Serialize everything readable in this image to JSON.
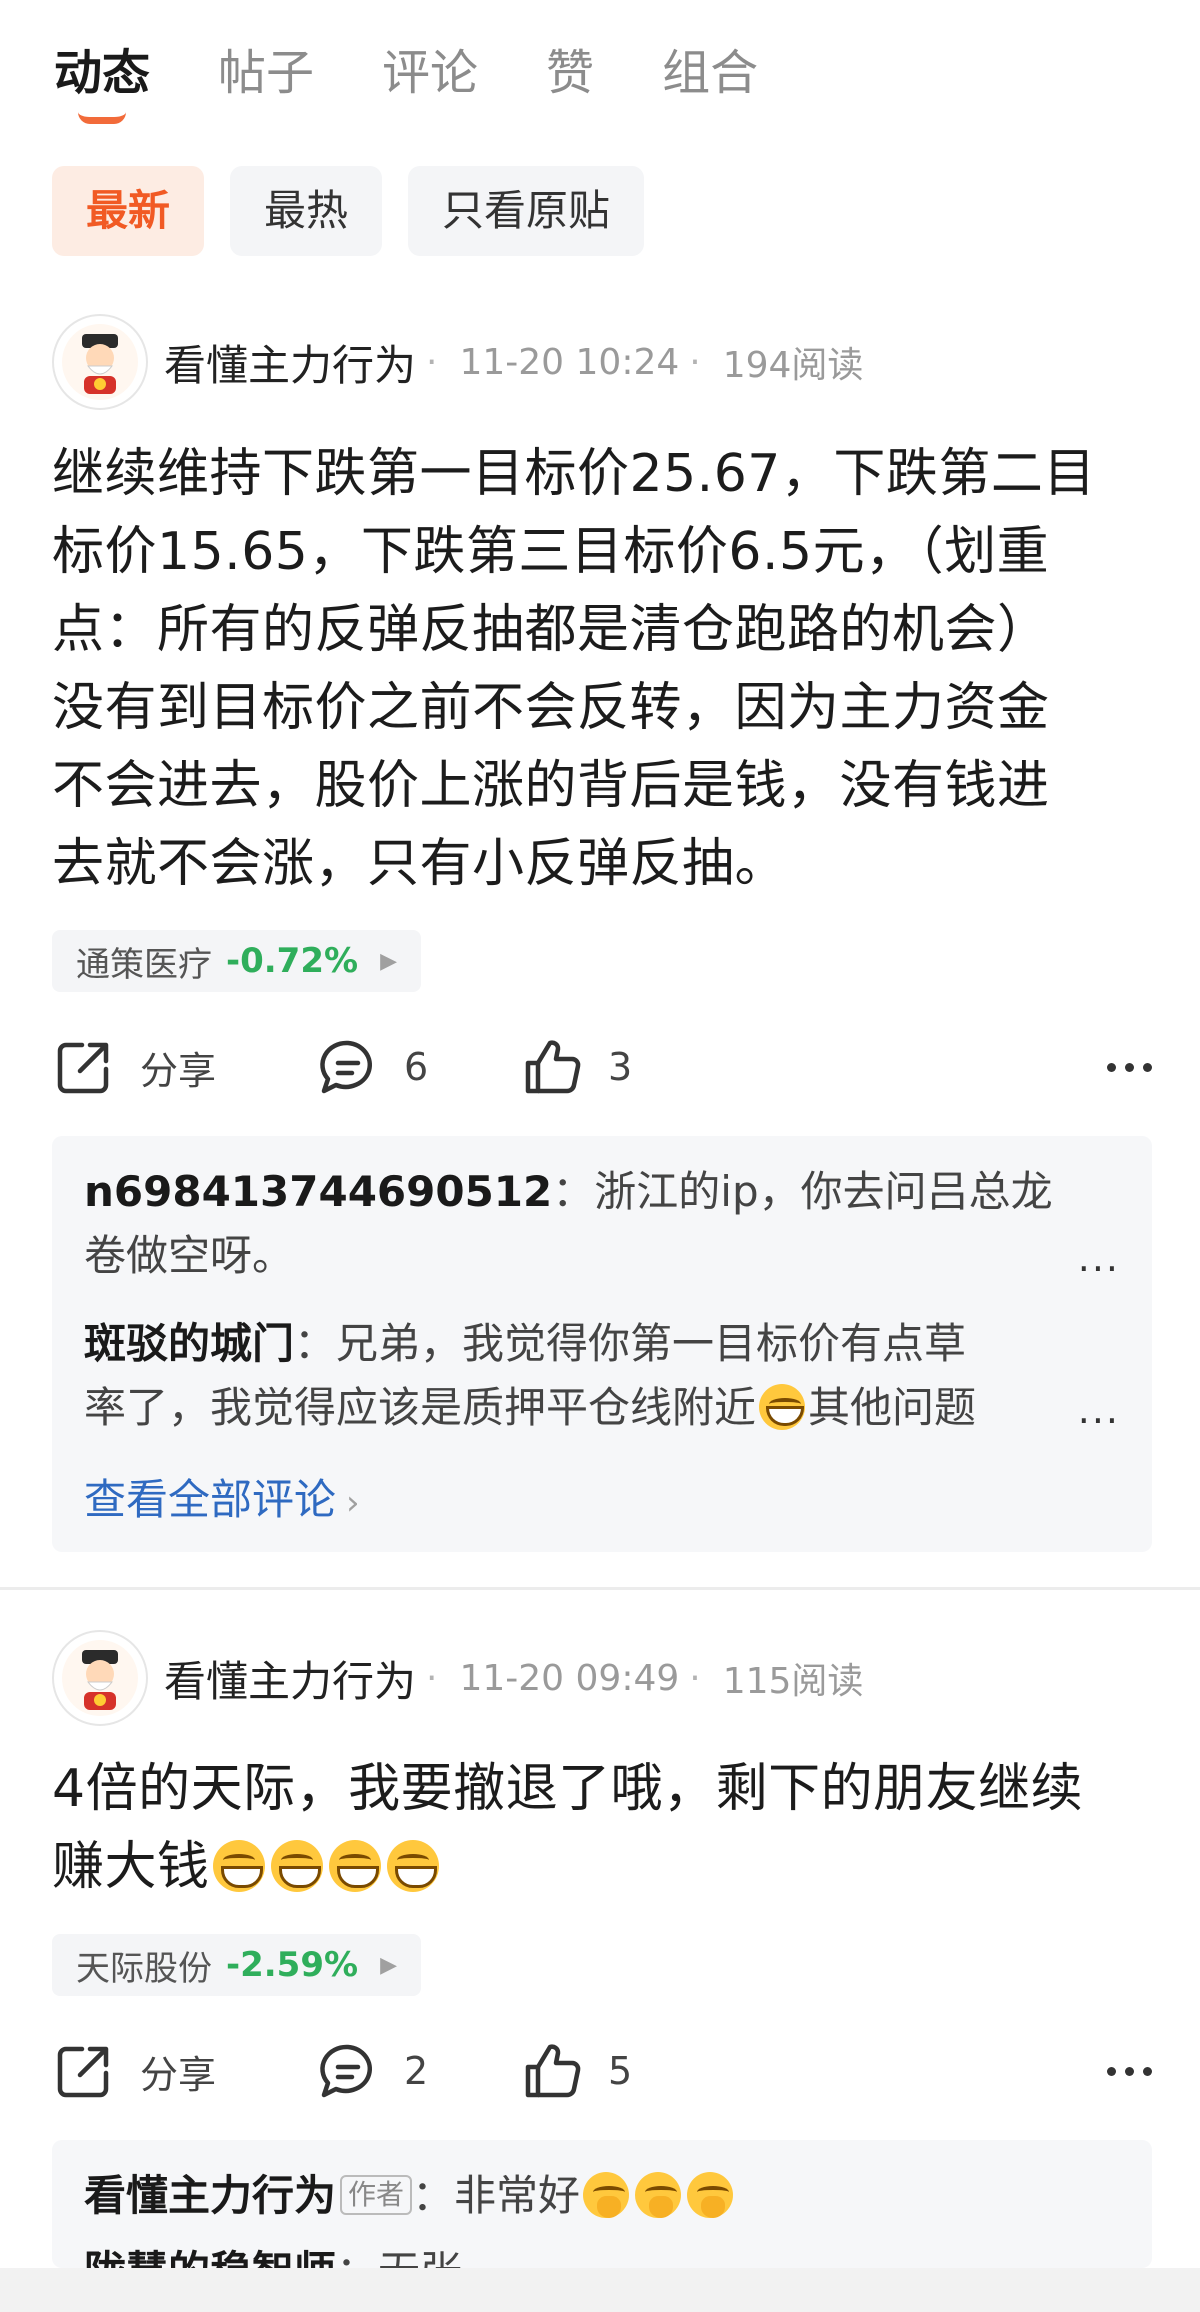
{
  "tabs": [
    {
      "label": "动态",
      "active": true
    },
    {
      "label": "帖子",
      "active": false
    },
    {
      "label": "评论",
      "active": false
    },
    {
      "label": "赞",
      "active": false
    },
    {
      "label": "组合",
      "active": false
    }
  ],
  "filters": [
    {
      "label": "最新",
      "active": true
    },
    {
      "label": "最热",
      "active": false
    },
    {
      "label": "只看原贴",
      "active": false
    }
  ],
  "colors": {
    "accent": "#f15a24",
    "down_green": "#2fae5b",
    "link_blue": "#2f6ac1"
  },
  "posts": [
    {
      "author": "看懂主力行为",
      "time": "11-20 10:24",
      "reads": "194阅读",
      "content_lines": [
        "继续维持下跌第一目标价25.67，下跌第二目",
        "标价15.65，下跌第三目标价6.5元，（划重",
        "点：所有的反弹反抽都是清仓跑路的机会）",
        "没有到目标价之前不会反转，因为主力资金",
        "不会进去，股价上涨的背后是钱，没有钱进",
        "去就不会涨，只有小反弹反抽。"
      ],
      "stock": {
        "name": "通策医疗",
        "change": "-0.72%"
      },
      "actions": {
        "share": "分享",
        "comments": "6",
        "likes": "3"
      },
      "comments": [
        {
          "user": "n698413744690512",
          "sep": "：",
          "line1": "浙江的ip，你去问吕总龙",
          "line2": "卷做空呀。"
        },
        {
          "user": "斑驳的城门",
          "sep": "：",
          "line1": "兄弟，我觉得你第一目标价有点草",
          "line2a": "率了，我觉得应该是质押平仓线附近",
          "line2b": "其他问题"
        }
      ],
      "view_all": "查看全部评论"
    },
    {
      "author": "看懂主力行为",
      "time": "11-20 09:49",
      "reads": "115阅读",
      "content_lines": [
        "4倍的天际，我要撤退了哦，剩下的朋友继续",
        "赚大钱"
      ],
      "stock": {
        "name": "天际股份",
        "change": "-2.59%"
      },
      "actions": {
        "share": "分享",
        "comments": "2",
        "likes": "5"
      },
      "comments": [
        {
          "user": "看懂主力行为",
          "badge": "作者",
          "sep": "：",
          "text": "非常好"
        },
        {
          "user": "陇慧的稳智师",
          "sep": "：",
          "text": "无张"
        }
      ]
    }
  ],
  "icons": [
    "share-icon",
    "comment-icon",
    "thumbs-up-icon",
    "more-icon",
    "avatar",
    "chevron-right-icon",
    "grin-emoji",
    "hand-over-mouth-emoji"
  ]
}
